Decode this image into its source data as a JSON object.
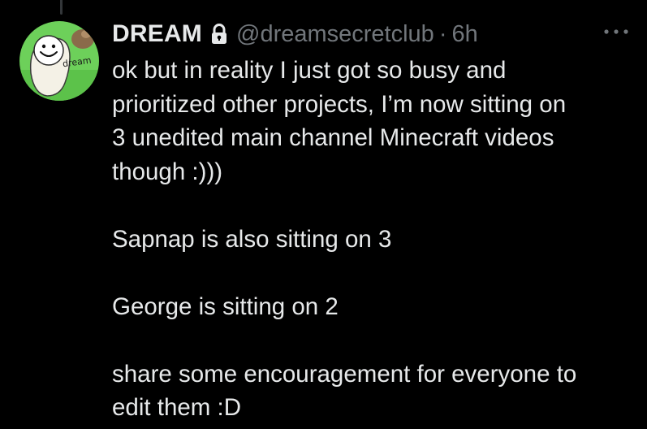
{
  "colors": {
    "background": "#000000",
    "primary_text": "#e7e9ea",
    "secondary_text": "#71767b",
    "thread_line": "#333639",
    "avatar_green": "#6dd05a"
  },
  "tweet": {
    "avatar": {
      "icon": "dream-smiley-avatar-icon",
      "label": "dream"
    },
    "display_name": "DREAM",
    "protected_icon": "lock-icon",
    "handle": "@dreamsecretclub",
    "separator": "·",
    "timestamp": "6h",
    "more_icon": "more-horizontal-icon",
    "paragraphs": [
      "ok but in reality I just got so busy and",
      "prioritized other projects, I’m now sitting on",
      "3 unedited main channel Minecraft videos",
      "though :)))",
      "",
      "Sapnap is also sitting on 3",
      "",
      "George is sitting on 2",
      "",
      "share some encouragement for everyone to",
      "edit them :D"
    ]
  }
}
